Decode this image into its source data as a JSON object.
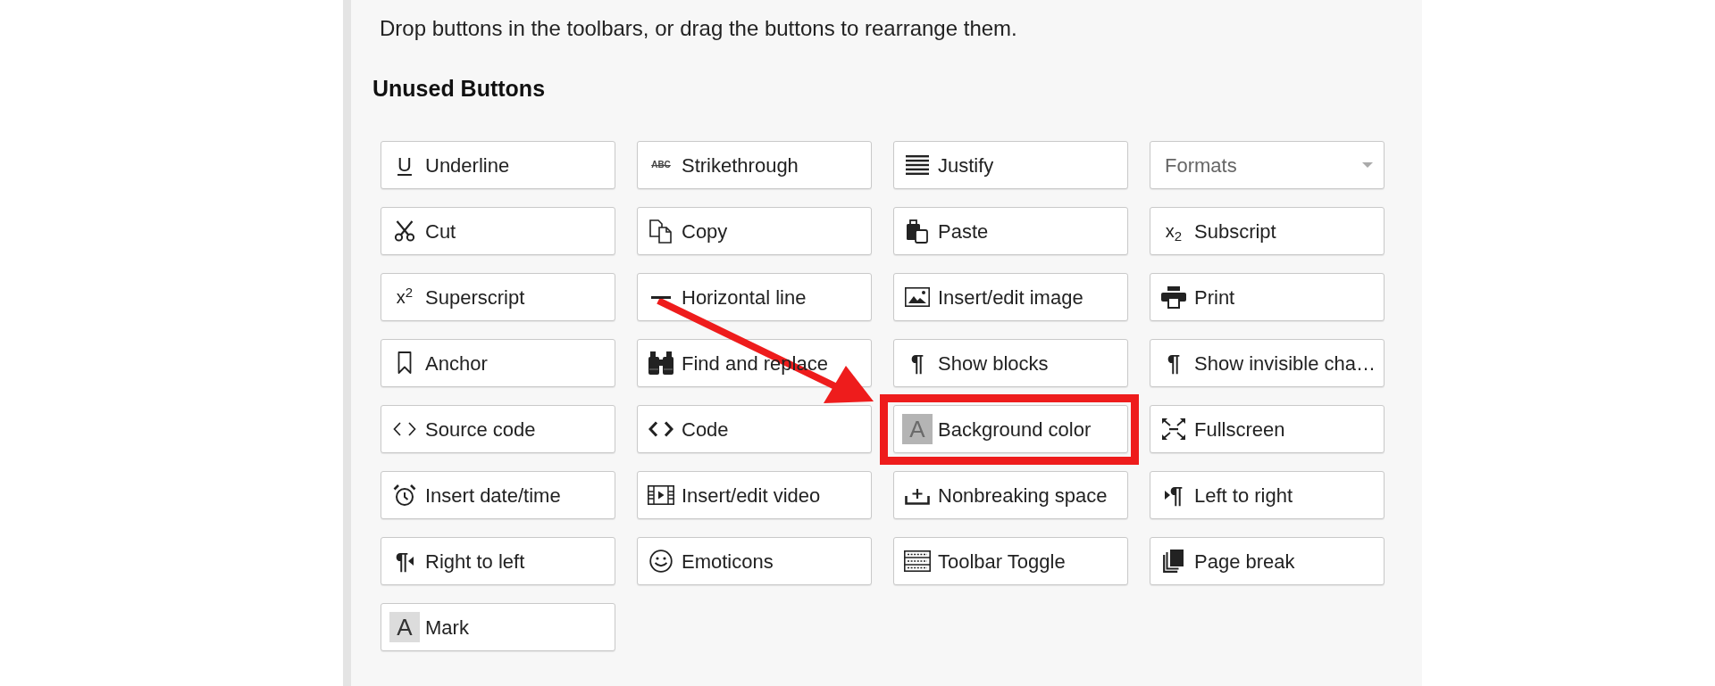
{
  "panel": {
    "instructions": "Drop buttons in the toolbars, or drag the buttons to rearrange them.",
    "heading": "Unused Buttons",
    "buttons": [
      {
        "kind": "button",
        "label": "Underline",
        "glyph": "U",
        "highlighted": false
      },
      {
        "kind": "button",
        "label": "Strikethrough",
        "glyph": "ABC",
        "highlighted": false
      },
      {
        "kind": "button",
        "label": "Justify",
        "highlighted": false
      },
      {
        "kind": "dropdown",
        "label": "Formats",
        "highlighted": false
      },
      {
        "kind": "button",
        "label": "Cut",
        "highlighted": false
      },
      {
        "kind": "button",
        "label": "Copy",
        "highlighted": false
      },
      {
        "kind": "button",
        "label": "Paste",
        "highlighted": false
      },
      {
        "kind": "button",
        "label": "Subscript",
        "glyph": "x$_{2}$",
        "highlighted": false
      },
      {
        "kind": "button",
        "label": "Superscript",
        "glyph": "x$^{2}$",
        "highlighted": false
      },
      {
        "kind": "button",
        "label": "Horizontal line",
        "highlighted": false
      },
      {
        "kind": "button",
        "label": "Insert/edit image",
        "highlighted": false
      },
      {
        "kind": "button",
        "label": "Print",
        "highlighted": false
      },
      {
        "kind": "button",
        "label": "Anchor",
        "highlighted": false
      },
      {
        "kind": "button",
        "label": "Find and replace",
        "highlighted": false
      },
      {
        "kind": "button",
        "label": "Show blocks",
        "glyph": "¶",
        "highlighted": false
      },
      {
        "kind": "button",
        "label": "Show invisible cha…",
        "glyph": "¶",
        "highlighted": false
      },
      {
        "kind": "button",
        "label": "Source code",
        "highlighted": false
      },
      {
        "kind": "button",
        "label": "Code",
        "highlighted": false
      },
      {
        "kind": "button",
        "label": "Background color",
        "glyph": "A",
        "highlighted": true
      },
      {
        "kind": "button",
        "label": "Fullscreen",
        "highlighted": false
      },
      {
        "kind": "button",
        "label": "Insert date/time",
        "highlighted": false
      },
      {
        "kind": "button",
        "label": "Insert/edit video",
        "highlighted": false
      },
      {
        "kind": "button",
        "label": "Nonbreaking space",
        "highlighted": false
      },
      {
        "kind": "button",
        "label": "Left to right",
        "glyph": "¶",
        "highlighted": false
      },
      {
        "kind": "button",
        "label": "Right to left",
        "glyph": "¶",
        "highlighted": false
      },
      {
        "kind": "button",
        "label": "Emoticons",
        "highlighted": false
      },
      {
        "kind": "button",
        "label": "Toolbar Toggle",
        "highlighted": false
      },
      {
        "kind": "button",
        "label": "Page break",
        "highlighted": false
      },
      {
        "kind": "button",
        "label": "Mark",
        "glyph": "A",
        "highlighted": false
      }
    ]
  }
}
